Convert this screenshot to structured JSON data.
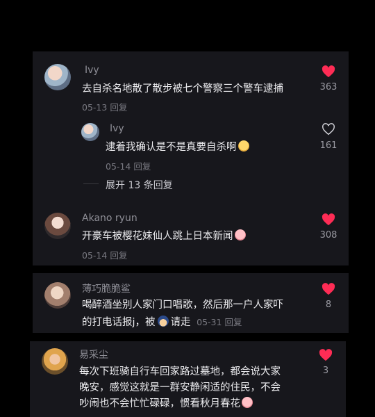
{
  "comments": [
    {
      "username": "Ivy",
      "text": "去自杀名地散了散步被七个警察三个警车逮捕",
      "date": "05-13",
      "reply_label": "回复",
      "likes": "363",
      "liked": true,
      "replies": [
        {
          "username": "Ivy",
          "text": "逮着我确认是不是真要自杀啊",
          "emoji": "grin-sweat-emoji",
          "date": "05-14",
          "reply_label": "回复",
          "likes": "161",
          "liked": false
        }
      ],
      "expand_label": "展开 13 条回复"
    },
    {
      "username": "Akano ryun",
      "text": "开豪车被樱花妹仙人跳上日本新闻",
      "emoji": "pig-emoji",
      "date": "05-14",
      "reply_label": "回复",
      "likes": "308",
      "liked": true
    },
    {
      "username": "薄巧脆脆鲨",
      "text_line1": "喝醉酒坐别人家门口唱歌，然后那一户人家吓",
      "text_line2a": "的打电话报j，被",
      "text_line2b": "请走",
      "emoji": "police-officer-emoji",
      "date": "05-31",
      "reply_label": "回复",
      "likes": "8",
      "liked": true
    },
    {
      "username": "易采尘",
      "text_line1": "每次下班骑自行车回家路过墓地，都会说大家",
      "text_line2": "晚安，感觉这就是一群安静闲适的住民，不会",
      "text_line3": "吵闹也不会忙忙碌碌，惯看秋月春花",
      "emoji": "pig-face-emoji",
      "likes": "3",
      "liked": true
    }
  ],
  "colors": {
    "heart_active": "#fe2c55",
    "heart_inactive": "#d0d0d6",
    "background": "#000000",
    "card": "#17171c"
  }
}
